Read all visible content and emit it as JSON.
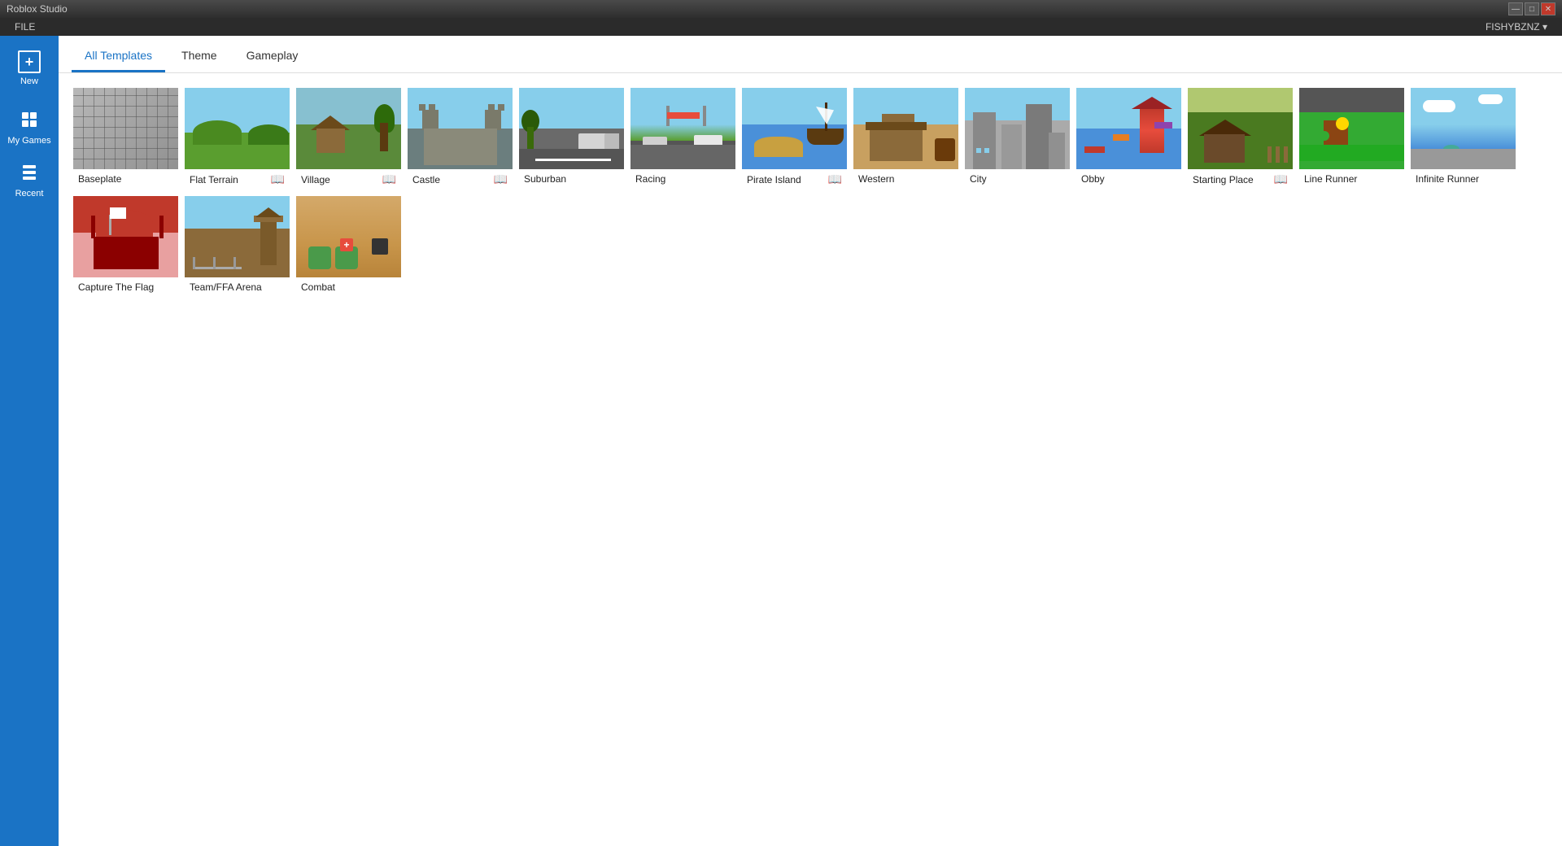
{
  "titlebar": {
    "title": "Roblox Studio",
    "username": "FISHYBZNZ ▾",
    "buttons": [
      "—",
      "□",
      "✕"
    ]
  },
  "menubar": {
    "items": [
      "FILE"
    ]
  },
  "sidebar": {
    "new_label": "New",
    "mygames_label": "My Games",
    "recent_label": "Recent"
  },
  "tabs": {
    "all_templates": "All Templates",
    "theme": "Theme",
    "gameplay": "Gameplay"
  },
  "templates": [
    {
      "id": "baseplate",
      "label": "Baseplate",
      "has_book": false,
      "thumb_class": "baseplate-grid"
    },
    {
      "id": "flat-terrain",
      "label": "Flat Terrain",
      "has_book": true,
      "thumb_class": ""
    },
    {
      "id": "village",
      "label": "Village",
      "has_book": true,
      "thumb_class": ""
    },
    {
      "id": "castle",
      "label": "Castle",
      "has_book": true,
      "thumb_class": ""
    },
    {
      "id": "suburban",
      "label": "Suburban",
      "has_book": false,
      "thumb_class": ""
    },
    {
      "id": "racing",
      "label": "Racing",
      "has_book": false,
      "thumb_class": ""
    },
    {
      "id": "pirate-island",
      "label": "Pirate Island",
      "has_book": true,
      "thumb_class": ""
    },
    {
      "id": "western",
      "label": "Western",
      "has_book": false,
      "thumb_class": ""
    },
    {
      "id": "city",
      "label": "City",
      "has_book": false,
      "thumb_class": ""
    },
    {
      "id": "obby",
      "label": "Obby",
      "has_book": false,
      "thumb_class": ""
    },
    {
      "id": "starting-place",
      "label": "Starting Place",
      "has_book": true,
      "thumb_class": ""
    },
    {
      "id": "line-runner",
      "label": "Line Runner",
      "has_book": false,
      "thumb_class": ""
    },
    {
      "id": "infinite-runner",
      "label": "Infinite Runner",
      "has_book": false,
      "thumb_class": ""
    },
    {
      "id": "capture-the-flag",
      "label": "Capture The Flag",
      "has_book": false,
      "thumb_class": ""
    },
    {
      "id": "team-ffa",
      "label": "Team/FFA Arena",
      "has_book": false,
      "thumb_class": ""
    },
    {
      "id": "combat",
      "label": "Combat",
      "has_book": false,
      "thumb_class": ""
    }
  ],
  "colors": {
    "sidebar_bg": "#1a73c5",
    "active_tab": "#1a73c5",
    "content_bg": "#ffffff",
    "app_bg": "#d4d4d4"
  }
}
